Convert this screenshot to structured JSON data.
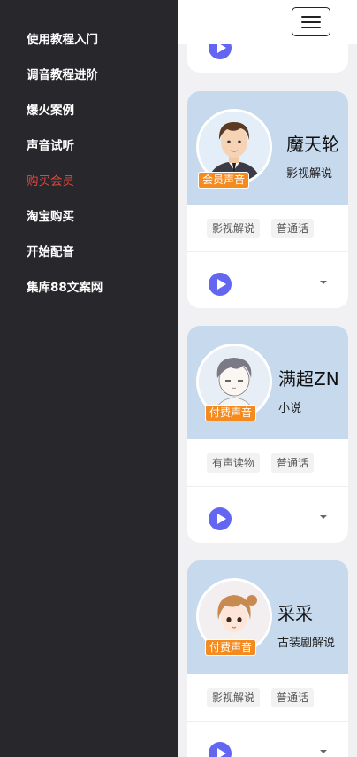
{
  "sidebar": {
    "items": [
      {
        "label": "使用教程入门"
      },
      {
        "label": "调音教程进阶"
      },
      {
        "label": "爆火案例"
      },
      {
        "label": "声音试听"
      },
      {
        "label": "购买会员"
      },
      {
        "label": "淘宝购买"
      },
      {
        "label": "开始配音"
      },
      {
        "label": "集库88文案网"
      }
    ],
    "active_index": 4,
    "active_color": "#e8453c"
  },
  "header": {
    "menu_icon": "hamburger-menu-icon"
  },
  "cards": [
    {
      "name": "魔天轮",
      "category": "影视解说",
      "badge": "会员声音",
      "tags": [
        "影视解说",
        "普通话"
      ]
    },
    {
      "name": "满超ZN",
      "category": "小说",
      "badge": "付费声音",
      "tags": [
        "有声读物",
        "普通话"
      ]
    },
    {
      "name": "采采",
      "category": "古装剧解说",
      "badge": "付费声音",
      "tags": [
        "影视解说",
        "普通话"
      ]
    }
  ],
  "colors": {
    "sidebar_bg": "#27272c",
    "card_header_bg": "#c7d9ed",
    "badge_bg": "#f58a1f",
    "play_button": "#6366f1"
  },
  "icons": {
    "play": "play-icon",
    "dropdown": "chevron-down-icon"
  }
}
